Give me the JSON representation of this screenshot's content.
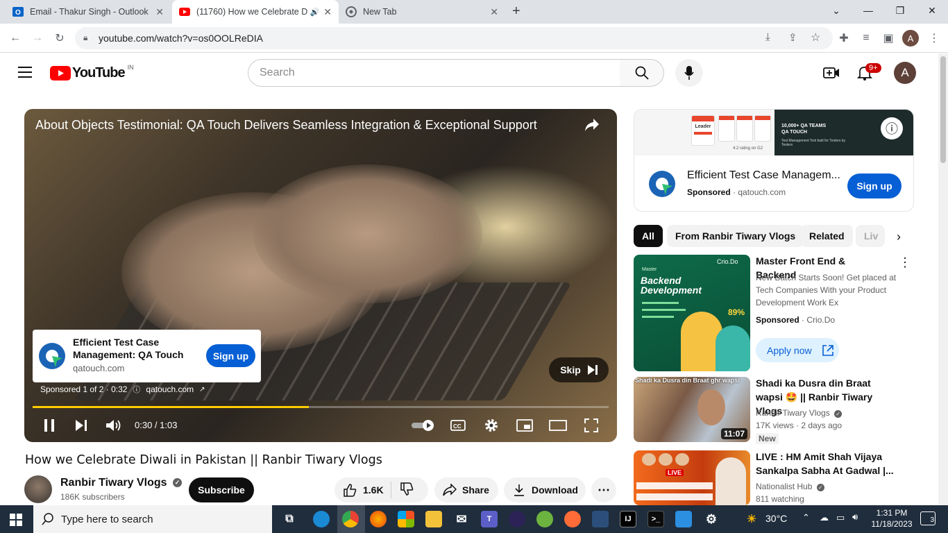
{
  "browser": {
    "tabs": [
      {
        "title": "Email - Thakur Singh - Outlook",
        "icon": "outlook-icon"
      },
      {
        "title": "(11760) How we Celebrate D",
        "icon": "youtube-icon",
        "active": true
      },
      {
        "title": "New Tab",
        "icon": "chrome-icon"
      }
    ],
    "url": "youtube.com/watch?v=os0OOLReDIA",
    "profile_initial": "A"
  },
  "youtube": {
    "logo_text": "YouTube",
    "region": "IN",
    "search_placeholder": "Search",
    "notification_count": "9+",
    "avatar_initial": "A"
  },
  "player": {
    "video_title": "About Objects Testimonial: QA Touch Delivers Seamless Integration & Exceptional Support",
    "ad_card": {
      "title": "Efficient Test Case Management: QA Touch",
      "domain": "qatouch.com",
      "cta": "Sign up"
    },
    "skip_label": "Skip",
    "ad_info": "Sponsored 1 of 2 · 0:32",
    "ad_domain": "qatouch.com",
    "progress": 0.48,
    "time": "0:30 / 1:03"
  },
  "video": {
    "title": "How we Celebrate Diwali in Pakistan || Ranbir Tiwary Vlogs",
    "channel": "Ranbir Tiwary Vlogs",
    "subscribers": "186K subscribers",
    "subscribe_label": "Subscribe",
    "likes": "1.6K",
    "share_label": "Share",
    "download_label": "Download"
  },
  "side_ad": {
    "banner_badge": "Leader",
    "banner_text": "10,000+ QA TEAMS",
    "banner_brand": "QA TOUCH",
    "banner_sub": "Test Management Tool built for Testers by Testers",
    "banner_rating": "4.2 rating on G2",
    "title": "Efficient Test Case Managem...",
    "sponsored": "Sponsored",
    "domain": "qatouch.com",
    "cta": "Sign up"
  },
  "chips": [
    "All",
    "From Ranbir Tiwary Vlogs",
    "Related",
    "Liv"
  ],
  "recommendations": [
    {
      "title": "Master Front End & Backend",
      "desc": "New Batch Starts Soon! Get placed at Tech Companies With your Product Development Work Ex",
      "sponsored": "Sponsored",
      "advertiser": "Crio.Do",
      "cta": "Apply now",
      "thumb_label": "Master",
      "thumb_heading": "Backend Development",
      "thumb_brand": "Crio.Do",
      "thumb_pct": "89%"
    },
    {
      "title": "Shadi ka Dusra din Braat wapsi 🤩 || Ranbir Tiwary Vlogs",
      "channel": "Ranbir Tiwary Vlogs",
      "meta": "17K views · 2 days ago",
      "badge": "New",
      "duration": "11:07",
      "thumb_caption": "Shadi ka Dusra din Braat ghr wapsi"
    },
    {
      "title": "LIVE : HM Amit Shah Vijaya Sankalpa Sabha At Gadwal |...",
      "channel": "Nationalist Hub",
      "meta": "811 watching",
      "thumb_badge": "LIVE"
    }
  ],
  "taskbar": {
    "search_placeholder": "Type here to search",
    "weather": "30°C",
    "time": "1:31 PM",
    "date": "11/18/2023",
    "notifications": "3"
  },
  "colors": {
    "youtube_red": "#ff0000",
    "accent_blue": "#065fd4",
    "progress_yellow": "#ffcc00"
  }
}
